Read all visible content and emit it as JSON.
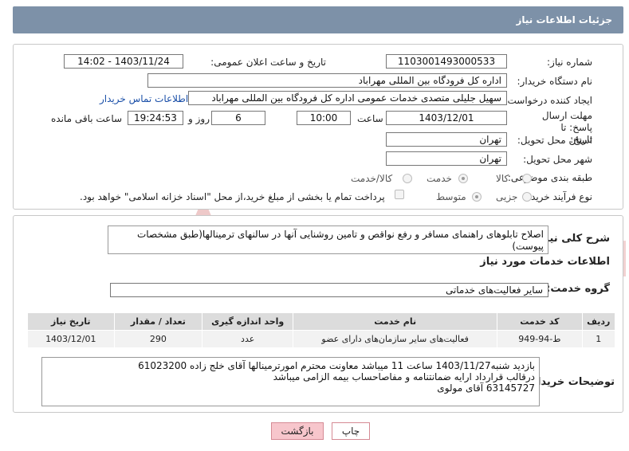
{
  "header": {
    "title": "جزئیات اطلاعات نیاز"
  },
  "form": {
    "need_number_label": "شماره نیاز:",
    "need_number": "1103001493000533",
    "announce_label": "تاریخ و ساعت اعلان عمومی:",
    "announce_value": "1403/11/24 - 14:02",
    "buyer_org_label": "نام دستگاه خریدار:",
    "buyer_org": "اداره کل فرودگاه بین المللی مهراباد",
    "creator_label": "ایجاد کننده درخواست:",
    "creator": "سهیل جلیلی متصدی خدمات عمومی اداره کل فرودگاه بین المللی مهراباد",
    "contact_link": "اطلاعات تماس خریدار",
    "deadline_label": "مهلت ارسال پاسخ: تا تاریخ:",
    "deadline_date": "1403/12/01",
    "time_label": "ساعت",
    "deadline_time": "10:00",
    "days_value": "6",
    "days_label": "روز و",
    "remaining_time": "19:24:53",
    "remaining_label": "ساعت باقی مانده",
    "province_label": "استان محل تحویل:",
    "province": "تهران",
    "city_label": "شهر محل تحویل:",
    "city": "تهران",
    "category_label": "طبقه بندی موضوعی:",
    "category_options": [
      "کالا",
      "خدمت",
      "کالا/خدمت"
    ],
    "category_selected": "خدمت",
    "process_label": "نوع فرآیند خرید :",
    "process_options": [
      "جزیی",
      "متوسط"
    ],
    "process_selected": "متوسط",
    "payment_note": "پرداخت تمام یا بخشی از مبلغ خرید،از محل \"اسناد خزانه اسلامی\" خواهد بود."
  },
  "details": {
    "general_desc_label": "شرح کلی نیاز:",
    "general_desc": "اصلاح تابلوهای راهنمای مسافر و رفع نواقص و تامین روشنایی آنها در سالنهای ترمینالها(طبق مشخصات پیوست)",
    "services_heading": "اطلاعات خدمات مورد نیاز",
    "service_group_label": "گروه خدمت:",
    "service_group": "سایر فعالیت‌های خدماتی",
    "table": {
      "headers": [
        "ردیف",
        "کد خدمت",
        "نام خدمت",
        "واحد اندازه گیری",
        "تعداد / مقدار",
        "تاریخ نیاز"
      ],
      "rows": [
        [
          "1",
          "ط-94-949",
          "فعالیت‌های سایر سازمان‌های دارای عضو",
          "عدد",
          "290",
          "1403/12/01"
        ]
      ]
    },
    "buyer_notes_label": "توضیحات خریدار:",
    "buyer_notes": [
      "بازدید شنبه1403/11/27 ساعت 11 میباشد معاونت محترم امورترمینالها آقای خلج زاده 61023200",
      "درقالب قرارداد ارایه ضمانتنامه و مفاصاحساب بیمه الزامی میباشد",
      "63145727 آقای مولوی"
    ]
  },
  "buttons": {
    "print": "چاپ",
    "back": "بازگشت"
  },
  "watermark": {
    "text": "AriaTender.neT"
  },
  "colors": {
    "header": "#7d91a8",
    "link": "#1a4fa8",
    "back_button": "#f7c6cc",
    "watermark": "#e8b4b4"
  }
}
